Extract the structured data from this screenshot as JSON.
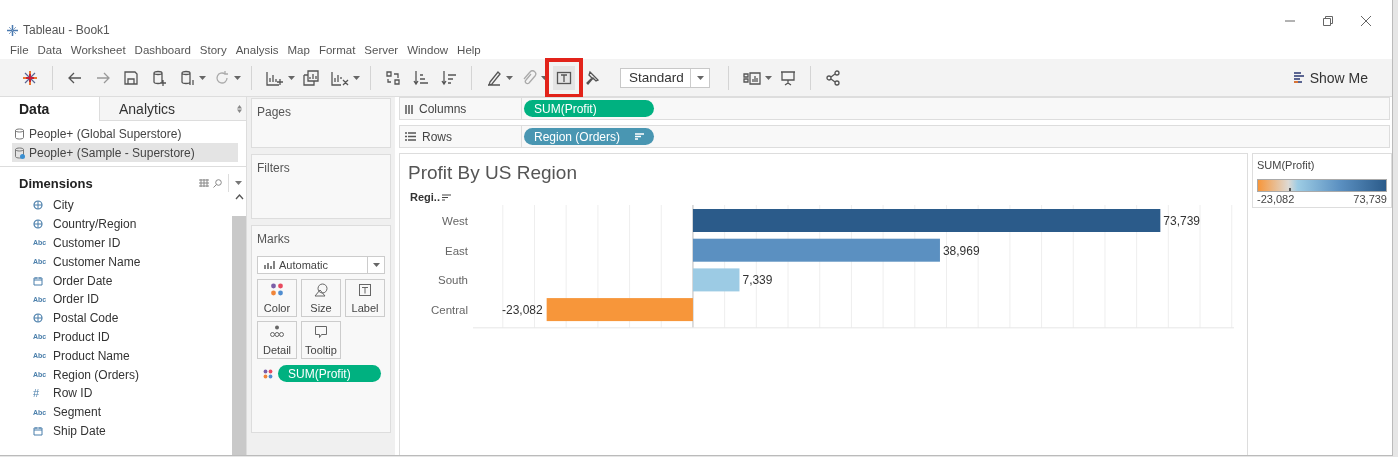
{
  "window": {
    "title": "Tableau - Book1"
  },
  "menu": [
    "File",
    "Data",
    "Worksheet",
    "Dashboard",
    "Story",
    "Analysis",
    "Map",
    "Format",
    "Server",
    "Window",
    "Help"
  ],
  "toolbar": {
    "text_tool_highlighted": true,
    "fit_value": "Standard",
    "show_me": "Show Me"
  },
  "data_pane": {
    "tabs": [
      {
        "label": "Data",
        "selected": true
      },
      {
        "label": "Analytics",
        "selected": false
      }
    ],
    "data_sources": [
      {
        "label": "People+ (Global Superstore)",
        "selected": false
      },
      {
        "label": "People+ (Sample - Superstore)",
        "selected": true
      }
    ],
    "dimensions_title": "Dimensions",
    "fields": [
      {
        "kind": "geo",
        "label": "City"
      },
      {
        "kind": "geo",
        "label": "Country/Region"
      },
      {
        "kind": "string",
        "badge": "Abc",
        "label": "Customer ID"
      },
      {
        "kind": "string",
        "badge": "Abc",
        "label": "Customer Name"
      },
      {
        "kind": "date",
        "label": "Order Date"
      },
      {
        "kind": "string",
        "badge": "Abc",
        "label": "Order ID"
      },
      {
        "kind": "geo",
        "label": "Postal Code"
      },
      {
        "kind": "string",
        "badge": "Abc",
        "label": "Product ID"
      },
      {
        "kind": "string",
        "badge": "Abc",
        "label": "Product Name"
      },
      {
        "kind": "string",
        "badge": "Abc",
        "label": "Region (Orders)"
      },
      {
        "kind": "number",
        "badge": "#",
        "label": "Row ID"
      },
      {
        "kind": "string",
        "badge": "Abc",
        "label": "Segment"
      },
      {
        "kind": "date",
        "label": "Ship Date"
      }
    ]
  },
  "pages_card": {
    "title": "Pages"
  },
  "filters_card": {
    "title": "Filters"
  },
  "marks_card": {
    "title": "Marks",
    "mark_type": "Automatic",
    "buttons": [
      {
        "kind": "color",
        "label": "Color"
      },
      {
        "kind": "size",
        "label": "Size"
      },
      {
        "kind": "label",
        "label": "Label"
      },
      {
        "kind": "detail",
        "label": "Detail"
      },
      {
        "kind": "tooltip",
        "label": "Tooltip"
      }
    ],
    "pills": [
      {
        "kind": "color",
        "label": "SUM(Profit)"
      }
    ]
  },
  "shelves": [
    {
      "kind": "columns",
      "label": "Columns",
      "pill": {
        "kind": "measure",
        "label": "SUM(Profit)"
      }
    },
    {
      "kind": "rows",
      "label": "Rows",
      "pill": {
        "kind": "dimension",
        "label": "Region (Orders)"
      }
    }
  ],
  "view": {
    "chart_data": {
      "type": "bar",
      "orientation": "horizontal",
      "title": "Profit By US Region",
      "ylabel": "Regi..",
      "categories": [
        "West",
        "East",
        "South",
        "Central"
      ],
      "series": [
        {
          "name": "SUM(Profit)",
          "values": [
            73739,
            38969,
            7339,
            -23082
          ],
          "value_labels": [
            "73,739",
            "38,969",
            "7,339",
            "-23,082"
          ]
        }
      ]
    }
  },
  "legend": {
    "min_label": "-23,082",
    "max_label": "73,739"
  }
}
